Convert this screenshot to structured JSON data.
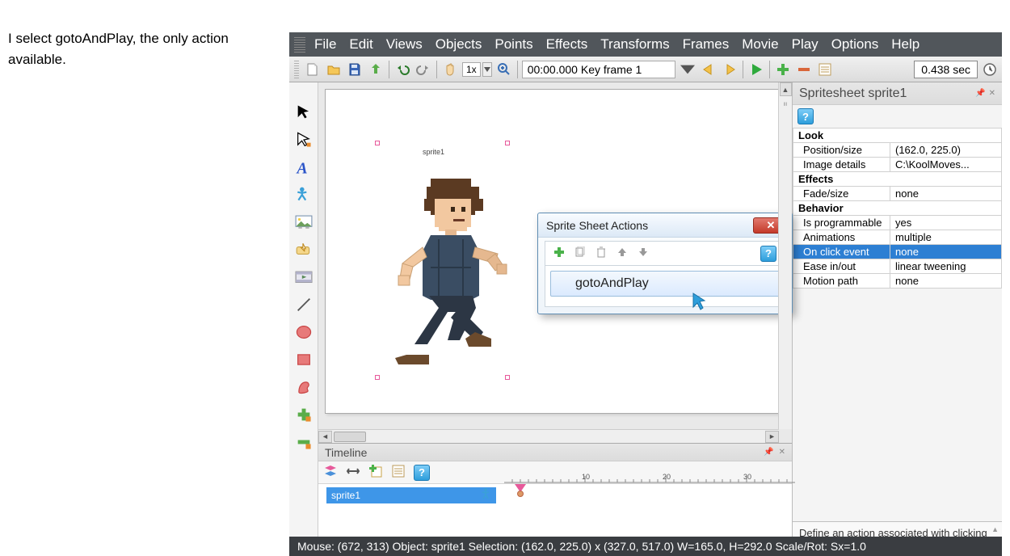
{
  "annotation": "I select gotoAndPlay, the only action available.",
  "menubar": {
    "items": [
      "File",
      "Edit",
      "Views",
      "Objects",
      "Points",
      "Effects",
      "Transforms",
      "Frames",
      "Movie",
      "Play",
      "Options",
      "Help"
    ]
  },
  "toolbar": {
    "zoom": "1x",
    "frame_label": "00:00.000  Key frame 1",
    "time": "0.438 sec"
  },
  "canvas": {
    "sprite_label": "sprite1"
  },
  "dialog": {
    "title": "Sprite Sheet Actions",
    "item": "gotoAndPlay"
  },
  "timeline": {
    "title": "Timeline",
    "row_label": "sprite1",
    "ticks": [
      "10",
      "20",
      "30"
    ]
  },
  "right": {
    "title": "Spritesheet sprite1",
    "sections": {
      "look": "Look",
      "effects": "Effects",
      "behavior": "Behavior"
    },
    "rows": {
      "position_size": {
        "label": "Position/size",
        "value": "(162.0, 225.0)"
      },
      "image_details": {
        "label": "Image details",
        "value": "C:\\KoolMoves..."
      },
      "fade_size": {
        "label": "Fade/size",
        "value": "none"
      },
      "is_programmable": {
        "label": "Is programmable",
        "value": "yes"
      },
      "animations": {
        "label": "Animations",
        "value": "multiple"
      },
      "on_click": {
        "label": "On click event",
        "value": "none"
      },
      "ease": {
        "label": "Ease in/out",
        "value": "linear tweening"
      },
      "motion": {
        "label": "Motion path",
        "value": "none"
      }
    },
    "desc": "Define an action associated with clicking on the sprite sheet"
  },
  "status": "Mouse: (672, 313)   Object: sprite1   Selection: (162.0, 225.0) x (327.0, 517.0)   W=165.0,  H=292.0  Scale/Rot: Sx=1.0"
}
